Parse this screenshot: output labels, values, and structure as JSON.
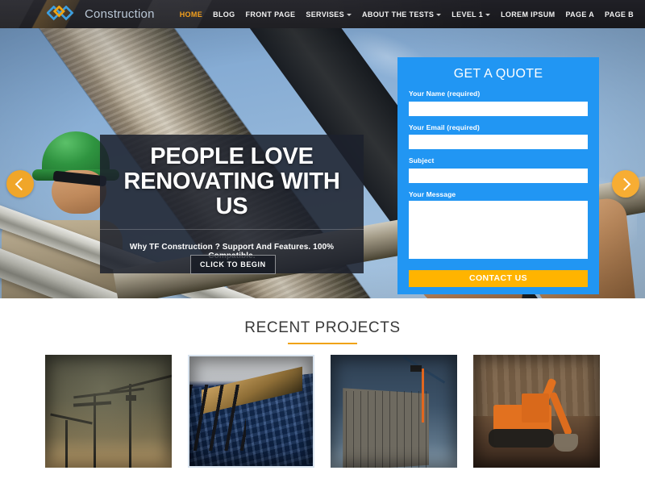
{
  "header": {
    "brand_name": "Construction",
    "logo_icon": "interlocking-diamonds-logo",
    "nav_items": [
      {
        "label": "HOME",
        "active": true,
        "has_caret": false
      },
      {
        "label": "BLOG",
        "active": false,
        "has_caret": false
      },
      {
        "label": "FRONT PAGE",
        "active": false,
        "has_caret": false
      },
      {
        "label": "SERVISES",
        "active": false,
        "has_caret": true
      },
      {
        "label": "ABOUT THE TESTS",
        "active": false,
        "has_caret": true
      },
      {
        "label": "LEVEL 1",
        "active": false,
        "has_caret": true
      },
      {
        "label": "LOREM IPSUM",
        "active": false,
        "has_caret": false
      },
      {
        "label": "PAGE A",
        "active": false,
        "has_caret": false
      },
      {
        "label": "PAGE B",
        "active": false,
        "has_caret": false
      }
    ]
  },
  "hero": {
    "title": "PEOPLE LOVE RENOVATING WITH US",
    "subtitle": "Why TF Construction ? Support And Features. 100% Compatible.",
    "cta_label": "CLICK TO BEGIN",
    "prev_icon": "chevron-left-icon",
    "next_icon": "chevron-right-icon",
    "dots": [
      {
        "active": false
      },
      {
        "active": false
      },
      {
        "active": true
      }
    ],
    "accent_color": "#f0a62a"
  },
  "quote_form": {
    "title": "GET A QUOTE",
    "panel_color": "#2196f3",
    "fields": [
      {
        "label": "Your Name (required)",
        "value": "",
        "placeholder": ""
      },
      {
        "label": "Your Email (required)",
        "value": "",
        "placeholder": ""
      },
      {
        "label": "Subject",
        "value": "",
        "placeholder": ""
      }
    ],
    "message": {
      "label": "Your Message",
      "value": "",
      "placeholder": ""
    },
    "submit_label": "CONTACT US",
    "submit_color": "#ffb400"
  },
  "projects": {
    "section_title": "RECENT PROJECTS",
    "underline_color": "#f0a311",
    "items": [
      {
        "name": "tower-cranes-at-dusk",
        "framed": false
      },
      {
        "name": "glass-skyscraper-upward",
        "framed": true
      },
      {
        "name": "highrise-under-construction",
        "framed": false
      },
      {
        "name": "orange-excavator-on-site",
        "framed": false
      }
    ]
  }
}
